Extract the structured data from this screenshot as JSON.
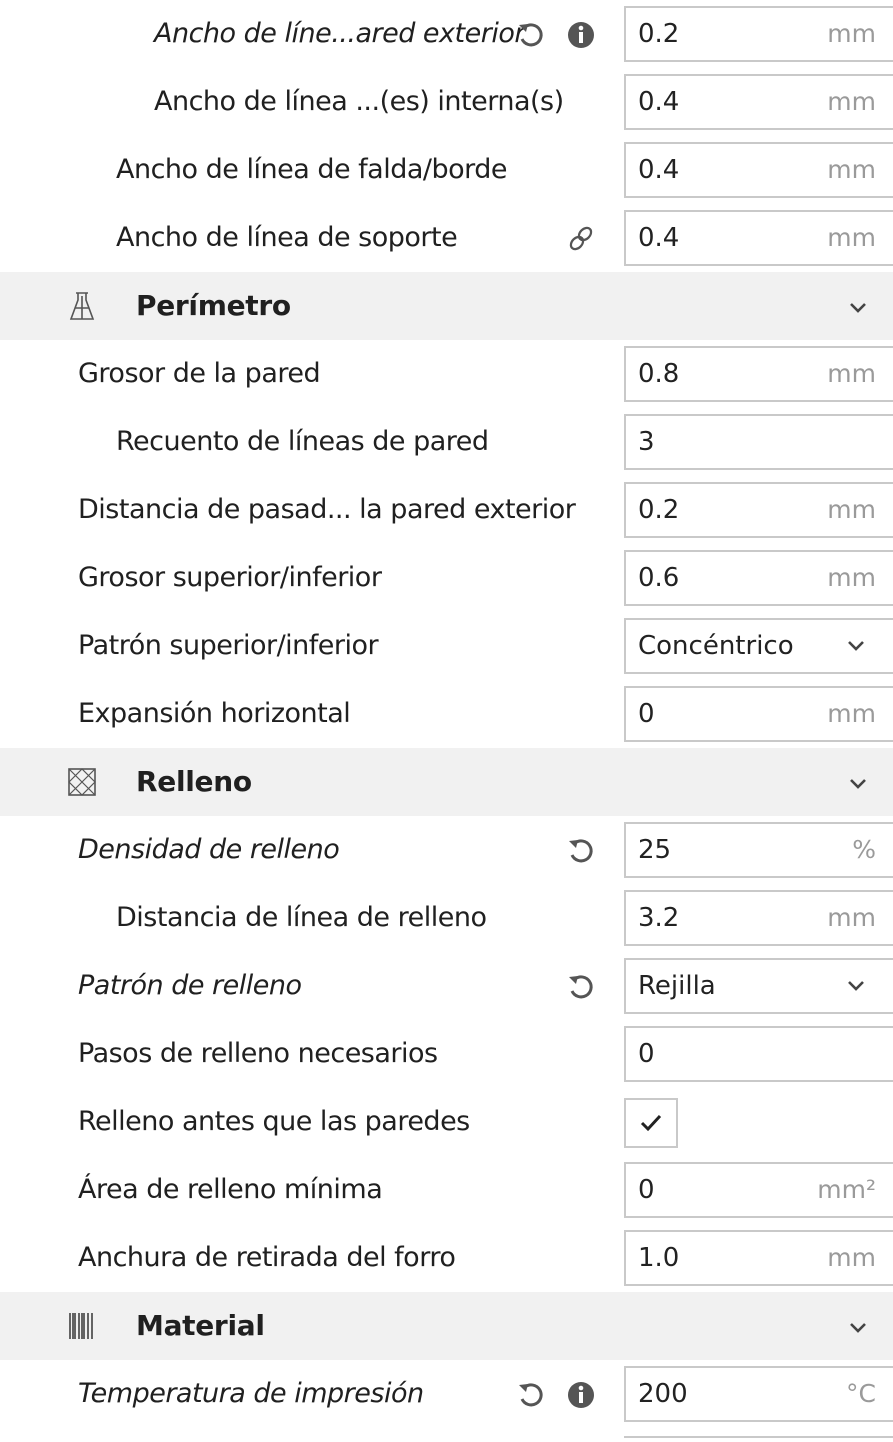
{
  "colors": {
    "border": "#c9c9c9",
    "section_bg": "#f1f1f1",
    "unit_text": "#9a9a9a",
    "icon": "#555555"
  },
  "rows": {
    "r1": {
      "label": "Ancho de líne...ared exterior",
      "value": "0.2",
      "unit": "mm"
    },
    "r2": {
      "label": "Ancho de línea ...(es) interna(s)",
      "value": "0.4",
      "unit": "mm"
    },
    "r3": {
      "label": "Ancho de línea de falda/borde",
      "value": "0.4",
      "unit": "mm"
    },
    "r4": {
      "label": "Ancho de línea de soporte",
      "value": "0.4",
      "unit": "mm"
    }
  },
  "sections": {
    "perimetro": {
      "title": "Perímetro",
      "icon": "perimeter-icon",
      "rows": [
        {
          "label": "Grosor de la pared",
          "value": "0.8",
          "unit": "mm"
        },
        {
          "label": "Recuento de líneas de pared",
          "value": "3",
          "unit": ""
        },
        {
          "label": "Distancia de pasad... la pared exterior",
          "value": "0.2",
          "unit": "mm"
        },
        {
          "label": "Grosor superior/inferior",
          "value": "0.6",
          "unit": "mm"
        },
        {
          "label": "Patrón superior/inferior",
          "value": "Concéntrico"
        },
        {
          "label": "Expansión horizontal",
          "value": "0",
          "unit": "mm"
        }
      ]
    },
    "relleno": {
      "title": "Relleno",
      "icon": "infill-icon",
      "rows": [
        {
          "label": "Densidad de relleno",
          "value": "25",
          "unit": "%"
        },
        {
          "label": "Distancia de línea de relleno",
          "value": "3.2",
          "unit": "mm"
        },
        {
          "label": "Patrón de relleno",
          "value": "Rejilla"
        },
        {
          "label": "Pasos de relleno necesarios",
          "value": "0",
          "unit": ""
        },
        {
          "label": "Relleno antes que las paredes",
          "checked": true
        },
        {
          "label": "Área de relleno mínima",
          "value": "0",
          "unit": "mm²"
        },
        {
          "label": "Anchura de retirada del forro",
          "value": "1.0",
          "unit": "mm"
        }
      ]
    },
    "material": {
      "title": "Material",
      "icon": "material-icon",
      "rows": [
        {
          "label": "Temperatura de impresión",
          "value": "200",
          "unit": "°C"
        }
      ]
    }
  }
}
